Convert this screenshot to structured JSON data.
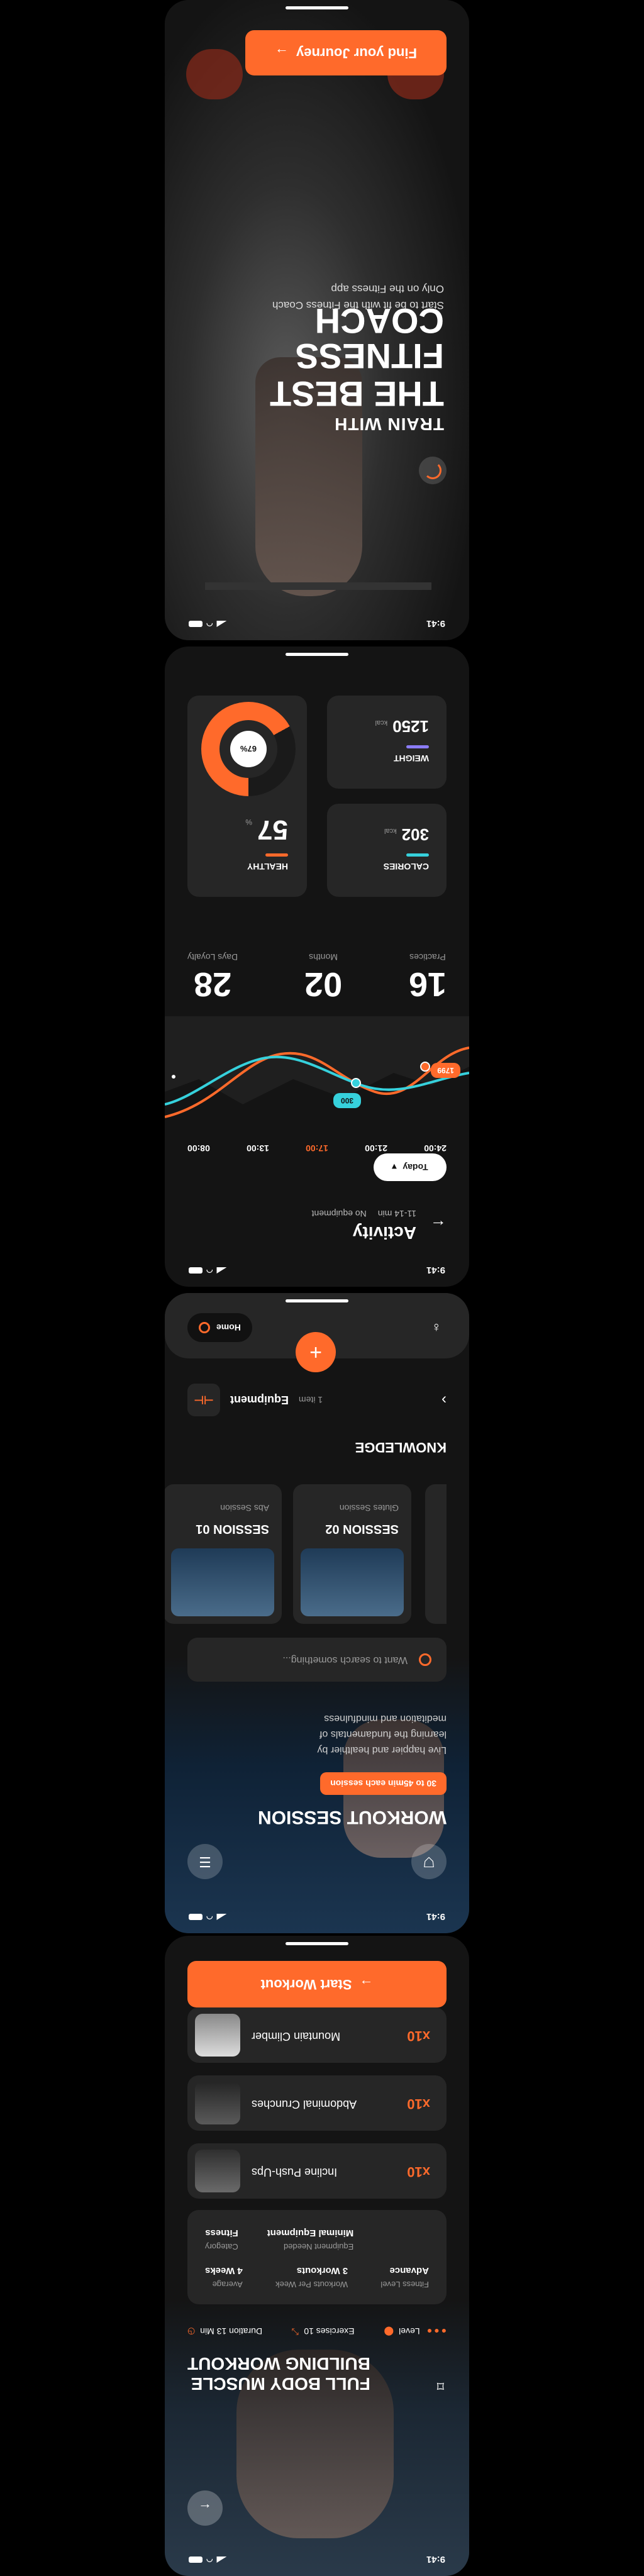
{
  "status": {
    "time": "9:41"
  },
  "screen1": {
    "cta": "Find your Journey",
    "headline_line1": "TRAIN WITH",
    "headline_line2": "THE BEST",
    "headline_line3": "FITNESS COACH",
    "subtitle_line1": "Start to be fit with the Fitness Coach",
    "subtitle_line2": "Only on the Fitness app"
  },
  "screen2": {
    "title": "Activity",
    "subtitle": "11-14 min",
    "subtitle2": "No equipment",
    "period": "Today",
    "times": [
      "08:00",
      "13:00",
      "17:00",
      "21:00",
      "24:00"
    ],
    "tooltip_teal": "300",
    "tooltip_orange": "1799",
    "stats": [
      {
        "value": "28",
        "label": "Days Loyalty"
      },
      {
        "value": "02",
        "label": "Months"
      },
      {
        "value": "16",
        "label": "Practices"
      }
    ],
    "healthy": {
      "value": "57",
      "unit": "%",
      "label": "HEALTHY",
      "ring_label": "67%"
    },
    "calories": {
      "value": "302",
      "unit": "kcal",
      "label": "CALORIES"
    },
    "weight": {
      "value": "1250",
      "unit": "kcal",
      "label": "WEIGHT"
    },
    "colors": {
      "accent": "#ff6a2b",
      "teal": "#36d1dc",
      "purple": "#8b7cf6"
    }
  },
  "screen3": {
    "title": "WORKOUT SESSION",
    "badge": "30 to 45min each session",
    "desc_line1": "Live happier and healthier by",
    "desc_line2": "learning the fundamentals of",
    "desc_line3": "meditation and mindfulness",
    "search_placeholder": "Want to search something...",
    "knowledge": "KNOWLEDGE",
    "sessions": [
      {
        "title": "SESSION 01",
        "sub": "Abs Session"
      },
      {
        "title": "SESSION 02",
        "sub": "Glutes Session"
      }
    ],
    "equipment_label": "Equipment",
    "equipment_count": "1 item",
    "nav_home": "Home"
  },
  "screen4": {
    "title_line1": "FULL BODY MUSCLE",
    "title_line2": "BUILDING WORKOUT",
    "meta": {
      "duration": "Duration 13 Min",
      "exercises": "Exercises 10",
      "level": "Level"
    },
    "info": [
      {
        "top": "Average",
        "bottom": "4 Weeks"
      },
      {
        "top": "Workouts Per Week",
        "bottom": "3 Workouts"
      },
      {
        "top": "Fitness Level",
        "bottom": "Advance"
      }
    ],
    "info2": [
      {
        "top": "Category",
        "bottom": "Fitness"
      },
      {
        "top": "Equipment Needed",
        "bottom": "Minimal Equipment"
      }
    ],
    "exercises": [
      {
        "name": "Incline Push-Ups",
        "reps": "x10"
      },
      {
        "name": "Abdominal Crunches",
        "reps": "x10"
      },
      {
        "name": "Mountain Climber",
        "reps": "x10"
      }
    ],
    "cta": "Start Workout"
  }
}
